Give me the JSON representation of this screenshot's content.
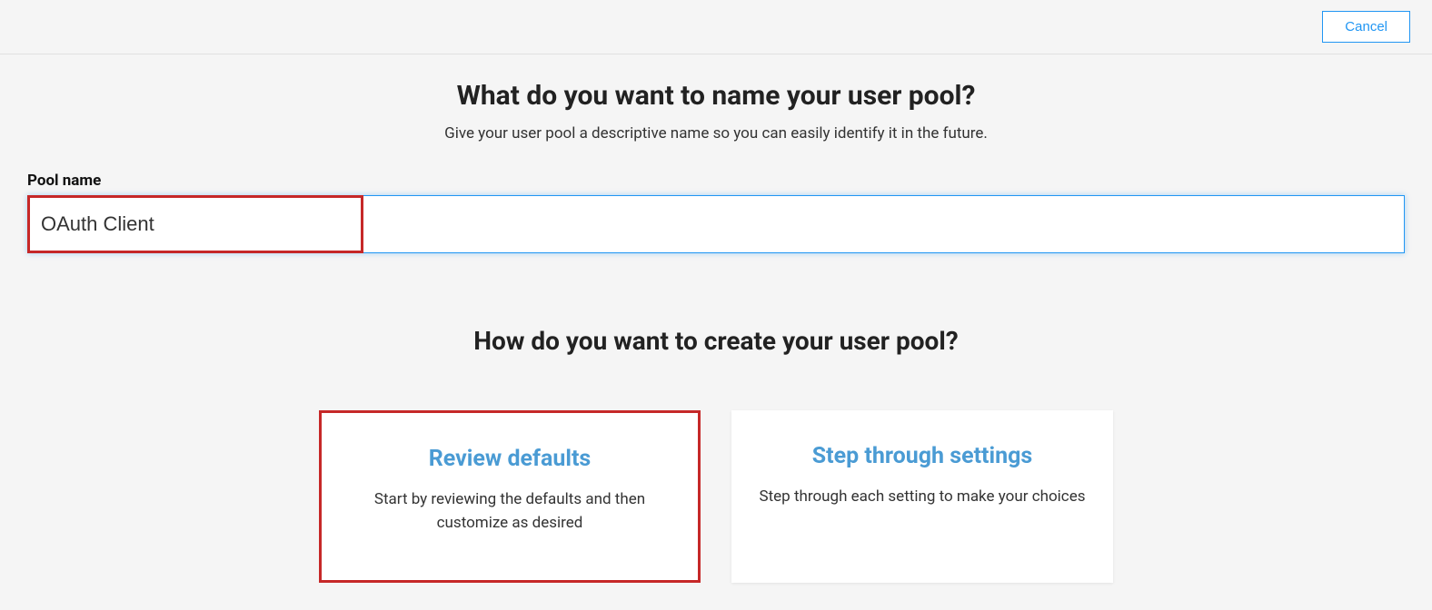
{
  "topbar": {
    "cancel_label": "Cancel"
  },
  "section1": {
    "heading": "What do you want to name your user pool?",
    "subheading": "Give your user pool a descriptive name so you can easily identify it in the future."
  },
  "form": {
    "pool_name_label": "Pool name",
    "pool_name_value": "OAuth Client"
  },
  "section2": {
    "heading": "How do you want to create your user pool?"
  },
  "options": {
    "review": {
      "title": "Review defaults",
      "description": "Start by reviewing the defaults and then customize as desired"
    },
    "step": {
      "title": "Step through settings",
      "description": "Step through each setting to make your choices"
    }
  }
}
